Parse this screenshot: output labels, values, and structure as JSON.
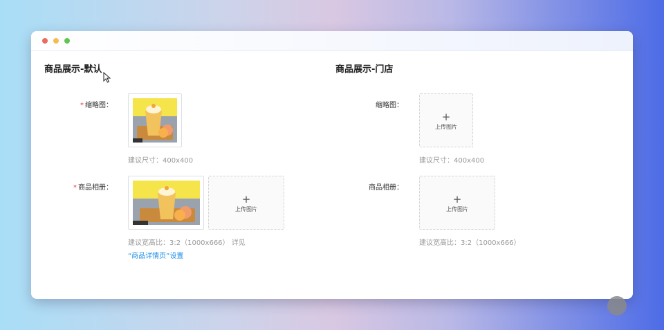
{
  "window": {
    "title": ""
  },
  "left": {
    "title": "商品展示-默认",
    "thumbnail_label": "缩略图：",
    "thumbnail_hint": "建议尺寸：400x400",
    "album_label": "商品相册：",
    "album_hint": "建议宽高比：3:2（1000x666） 详见",
    "album_link": "“商品详情页”设置",
    "upload_text": "上传图片",
    "required_mark": "*"
  },
  "right": {
    "title": "商品展示-门店",
    "thumbnail_label": "缩略图：",
    "thumbnail_hint": "建议尺寸：400x400",
    "album_label": "商品相册：",
    "album_hint": "建议宽高比：3:2（1000x666）",
    "upload_text": "上传图片"
  },
  "icons": {
    "plus": "plus-icon",
    "cursor": "mouse-cursor-icon"
  },
  "colors": {
    "required": "#e4393c",
    "link": "#1f8fe8",
    "hint": "#999999"
  }
}
